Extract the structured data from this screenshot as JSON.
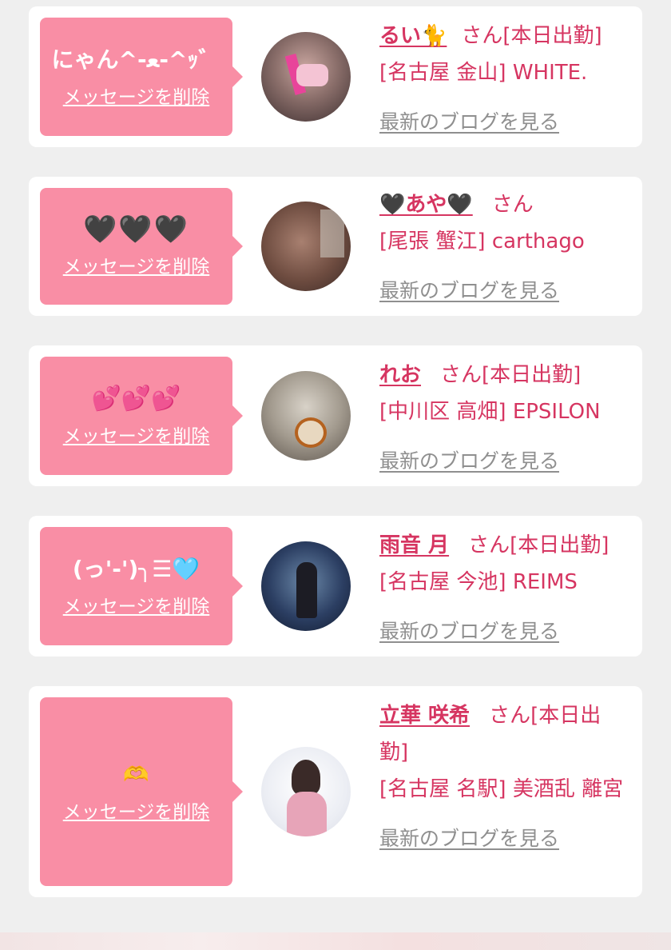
{
  "common": {
    "delete_label": "メッセージを削除",
    "blog_label": "最新のブログを見る",
    "honorific": "さん"
  },
  "colors": {
    "bubble": "#f98ea5",
    "accent": "#d63561",
    "link_gray": "#8f8f8f",
    "background": "#efefef"
  },
  "messages": [
    {
      "message": "にゃん^-ﻌ-^ｯ゛",
      "name": "るい🐈",
      "status": "[本日出勤]",
      "area": "[名古屋 金山] WHITE."
    },
    {
      "message": "🖤🖤🖤",
      "name": "🖤あや🖤",
      "status": "",
      "area": "[尾張 蟹江] carthago"
    },
    {
      "message": "💕💕💕",
      "name": "れお",
      "status": "[本日出勤]",
      "area": "[中川区 高畑] EPSILON"
    },
    {
      "message": "(っ'-')╮☰🩵",
      "name": "雨音 月",
      "status": "[本日出勤]",
      "area": "[名古屋 今池] REIMS"
    },
    {
      "message": "🫶",
      "name": "立華 咲希",
      "status": "[本日出勤]",
      "area": "[名古屋 名駅] 美酒乱 離宮"
    }
  ]
}
